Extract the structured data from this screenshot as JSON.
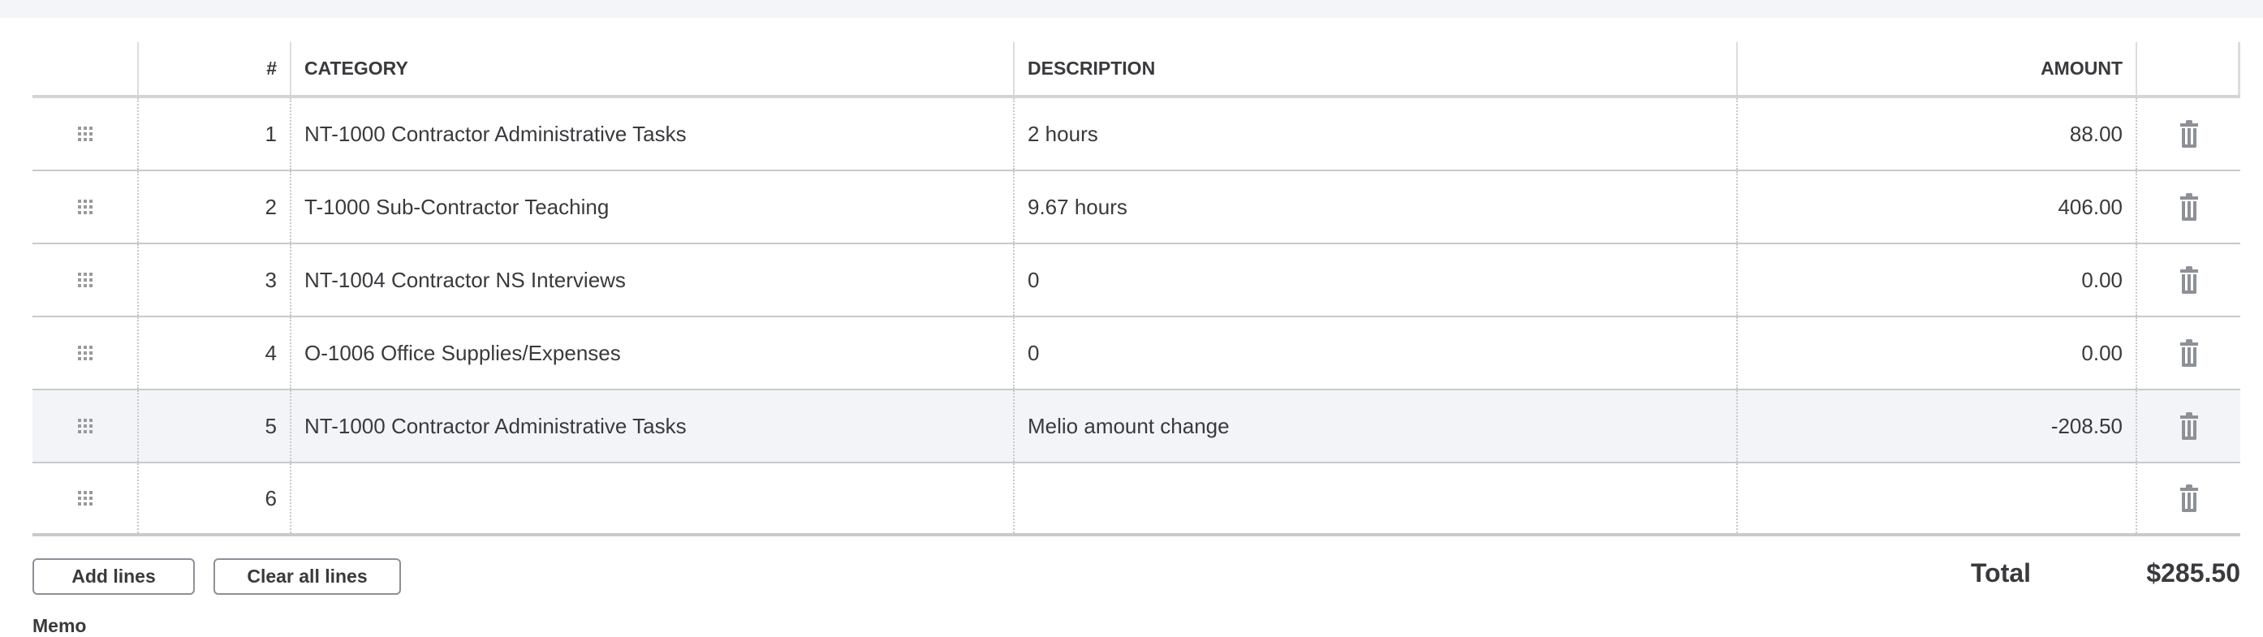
{
  "table": {
    "headers": {
      "num": "#",
      "category": "CATEGORY",
      "description": "DESCRIPTION",
      "amount": "AMOUNT"
    },
    "rows": [
      {
        "num": "1",
        "category": "NT-1000 Contractor Administrative Tasks",
        "description": "2 hours",
        "amount": "88.00"
      },
      {
        "num": "2",
        "category": "T-1000 Sub-Contractor Teaching",
        "description": "9.67 hours",
        "amount": "406.00"
      },
      {
        "num": "3",
        "category": "NT-1004 Contractor NS Interviews",
        "description": "0",
        "amount": "0.00"
      },
      {
        "num": "4",
        "category": "O-1006 Office Supplies/Expenses",
        "description": "0",
        "amount": "0.00"
      },
      {
        "num": "5",
        "category": "NT-1000 Contractor Administrative Tasks",
        "description": "Melio amount change",
        "amount": "-208.50"
      },
      {
        "num": "6",
        "category": "",
        "description": "",
        "amount": ""
      }
    ]
  },
  "actions": {
    "add_lines": "Add lines",
    "clear_all_lines": "Clear all lines"
  },
  "total": {
    "label": "Total",
    "value": "$285.50"
  },
  "memo_label": "Memo"
}
